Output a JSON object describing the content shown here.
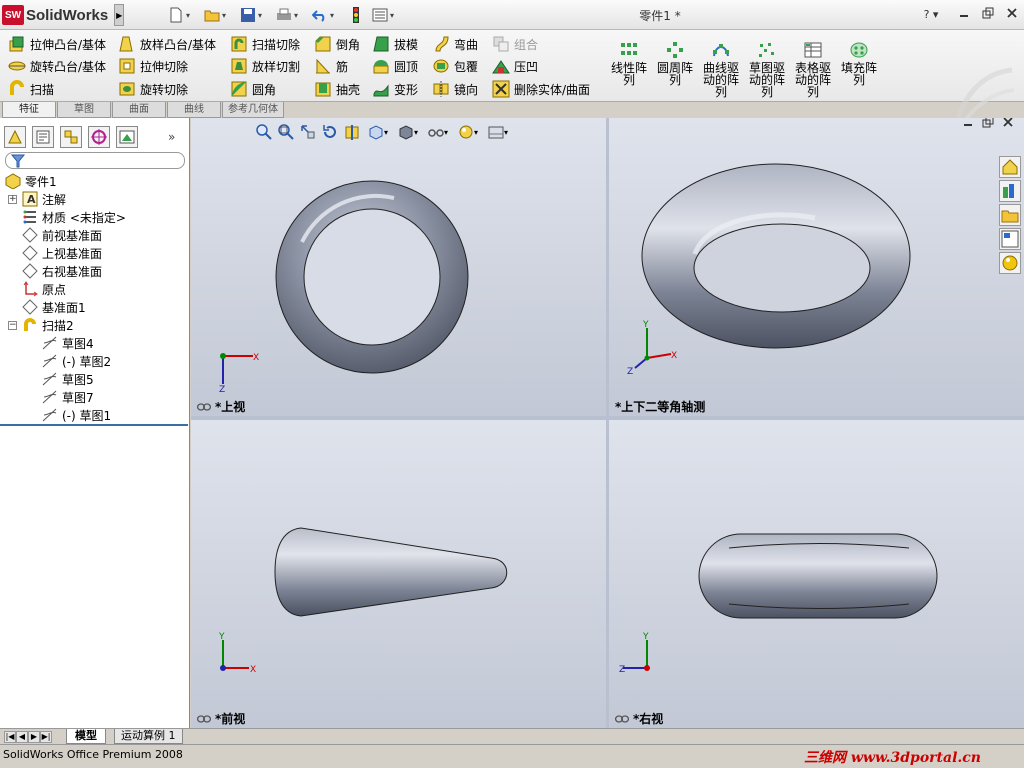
{
  "app": {
    "name": "SolidWorks",
    "logo_text": "SW",
    "document_title": "零件1 *",
    "help_label": "?"
  },
  "command_manager": {
    "col1": [
      "拉伸凸台/基体",
      "旋转凸台/基体",
      "扫描"
    ],
    "col2": [
      "放样凸台/基体",
      "拉伸切除",
      "旋转切除"
    ],
    "col3": [
      "扫描切除",
      "放样切割",
      "圆角"
    ],
    "col4": [
      "倒角",
      "筋",
      "抽壳"
    ],
    "col5": [
      "拔模",
      "圆顶",
      "变形"
    ],
    "col6": [
      "弯曲",
      "包覆",
      "镜向"
    ],
    "col7": [
      "组合",
      "压凹",
      "删除实体/曲面"
    ],
    "patterns": [
      "线性阵\n列",
      "圆周阵\n列",
      "曲线驱\n动的阵\n列",
      "草图驱\n动的阵\n列",
      "表格驱\n动的阵\n列",
      "填充阵\n列"
    ],
    "disabled_item": "组合"
  },
  "tabs": [
    "特征",
    "草图",
    "曲面",
    "曲线",
    "参考几何体"
  ],
  "feature_tree": {
    "root": "零件1",
    "items": [
      {
        "label": "注解",
        "icon": "annotation-icon",
        "expander": "+"
      },
      {
        "label": "材质 <未指定>",
        "icon": "material-icon"
      },
      {
        "label": "前视基准面",
        "icon": "plane-icon"
      },
      {
        "label": "上视基准面",
        "icon": "plane-icon"
      },
      {
        "label": "右视基准面",
        "icon": "plane-icon"
      },
      {
        "label": "原点",
        "icon": "origin-icon"
      },
      {
        "label": "基准面1",
        "icon": "plane-icon"
      },
      {
        "label": "扫描2",
        "icon": "sweep-icon",
        "expander": "−"
      }
    ],
    "children": [
      "草图4",
      "(-) 草图2",
      "草图5",
      "草图7",
      "(-) 草图1"
    ]
  },
  "viewports": {
    "top": "*上视",
    "iso": "*上下二等角轴测",
    "front": "*前视",
    "right": "*右视"
  },
  "axes": {
    "x": "X",
    "y": "Y",
    "z": "Z"
  },
  "bottom_tabs": [
    "模型",
    "运动算例 1"
  ],
  "status": {
    "text": "SolidWorks Office Premium 2008",
    "site": "三维网 www.3dportal.cn"
  },
  "colors": {
    "accent": "#c8102e",
    "viewport_bg": "#d3d8e2",
    "model": "#7f8798"
  }
}
